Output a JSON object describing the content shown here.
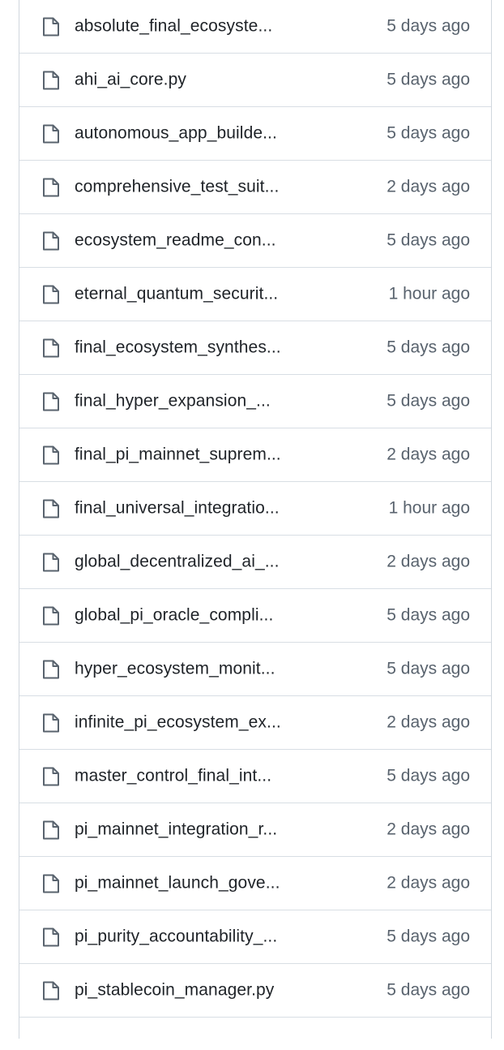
{
  "files": [
    {
      "name": "absolute_final_ecosyste...",
      "age": "5 days ago",
      "icon": "file-icon"
    },
    {
      "name": "ahi_ai_core.py",
      "age": "5 days ago",
      "icon": "file-icon"
    },
    {
      "name": "autonomous_app_builde...",
      "age": "5 days ago",
      "icon": "file-icon"
    },
    {
      "name": "comprehensive_test_suit...",
      "age": "2 days ago",
      "icon": "file-icon"
    },
    {
      "name": "ecosystem_readme_con...",
      "age": "5 days ago",
      "icon": "file-icon"
    },
    {
      "name": "eternal_quantum_securit...",
      "age": "1 hour ago",
      "icon": "file-icon"
    },
    {
      "name": "final_ecosystem_synthes...",
      "age": "5 days ago",
      "icon": "file-icon"
    },
    {
      "name": "final_hyper_expansion_...",
      "age": "5 days ago",
      "icon": "file-icon"
    },
    {
      "name": "final_pi_mainnet_suprem...",
      "age": "2 days ago",
      "icon": "file-icon"
    },
    {
      "name": "final_universal_integratio...",
      "age": "1 hour ago",
      "icon": "file-icon"
    },
    {
      "name": "global_decentralized_ai_...",
      "age": "2 days ago",
      "icon": "file-icon"
    },
    {
      "name": "global_pi_oracle_compli...",
      "age": "5 days ago",
      "icon": "file-icon"
    },
    {
      "name": "hyper_ecosystem_monit...",
      "age": "5 days ago",
      "icon": "file-icon"
    },
    {
      "name": "infinite_pi_ecosystem_ex...",
      "age": "2 days ago",
      "icon": "file-icon"
    },
    {
      "name": "master_control_final_int...",
      "age": "5 days ago",
      "icon": "file-icon"
    },
    {
      "name": "pi_mainnet_integration_r...",
      "age": "2 days ago",
      "icon": "file-icon"
    },
    {
      "name": "pi_mainnet_launch_gove...",
      "age": "2 days ago",
      "icon": "file-icon"
    },
    {
      "name": "pi_purity_accountability_...",
      "age": "5 days ago",
      "icon": "file-icon"
    },
    {
      "name": "pi_stablecoin_manager.py",
      "age": "5 days ago",
      "icon": "file-icon"
    }
  ],
  "colors": {
    "border": "#d0d7de",
    "row_divider": "#d8dee4",
    "file_name_text": "#1f2328",
    "age_text": "#59636e",
    "icon_stroke": "#59636e"
  }
}
